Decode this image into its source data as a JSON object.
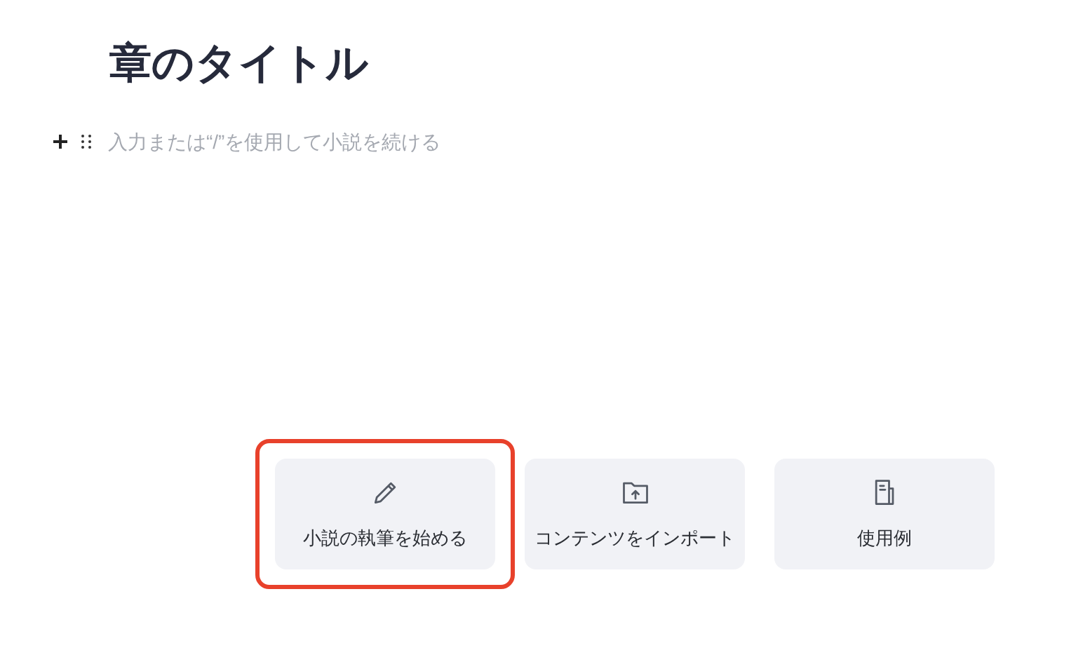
{
  "title": "章のタイトル",
  "editor": {
    "placeholder": "入力または“/”を使用して小説を続ける"
  },
  "actions": [
    {
      "kind": "pencil",
      "label": "小説の執筆を始める",
      "selected": true
    },
    {
      "kind": "import",
      "label": "コンテンツをインポート",
      "selected": false
    },
    {
      "kind": "example",
      "label": "使用例",
      "selected": false
    }
  ]
}
